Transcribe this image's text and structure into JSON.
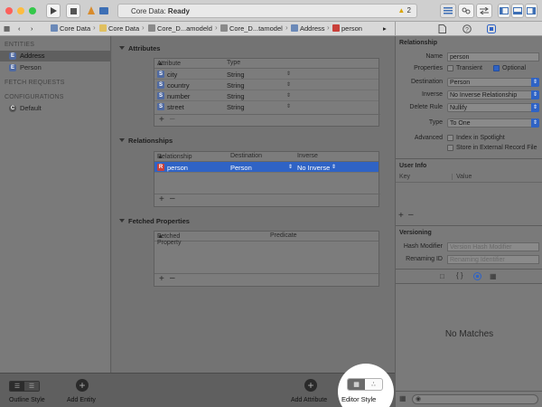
{
  "titlebar": {
    "status_prefix": "Core Data:",
    "status_value": "Ready",
    "warning_count": "2"
  },
  "breadcrumb": {
    "items": [
      "Core Data",
      "Core Data",
      "Core_D...amodeld",
      "Core_D...tamodel",
      "Address",
      "person"
    ]
  },
  "outline": {
    "entities_header": "ENTITIES",
    "entities": [
      {
        "label": "Address",
        "icon": "E",
        "selected": true
      },
      {
        "label": "Person",
        "icon": "E",
        "selected": false
      }
    ],
    "fetch_header": "FETCH REQUESTS",
    "config_header": "CONFIGURATIONS",
    "configurations": [
      {
        "label": "Default",
        "icon": "C"
      }
    ]
  },
  "attributes": {
    "title": "Attributes",
    "col_attribute": "Attribute",
    "col_type": "Type",
    "rows": [
      {
        "name": "city",
        "type": "String"
      },
      {
        "name": "country",
        "type": "String"
      },
      {
        "name": "number",
        "type": "String"
      },
      {
        "name": "street",
        "type": "String"
      }
    ]
  },
  "relationships": {
    "title": "Relationships",
    "col_relationship": "Relationship",
    "col_destination": "Destination",
    "col_inverse": "Inverse",
    "rows": [
      {
        "name": "person",
        "destination": "Person",
        "inverse": "No Inverse",
        "selected": true
      }
    ]
  },
  "fetched": {
    "title": "Fetched Properties",
    "col_property": "Fetched Property",
    "col_predicate": "Predicate"
  },
  "inspector": {
    "relationship_title": "Relationship",
    "name_label": "Name",
    "name_value": "person",
    "properties_label": "Properties",
    "transient_label": "Transient",
    "optional_label": "Optional",
    "destination_label": "Destination",
    "destination_value": "Person",
    "inverse_label": "Inverse",
    "inverse_value": "No Inverse Relationship",
    "delete_label": "Delete Rule",
    "delete_value": "Nullify",
    "type_label": "Type",
    "type_value": "To One",
    "advanced_label": "Advanced",
    "index_label": "Index in Spotlight",
    "external_label": "Store in External Record File",
    "userinfo_title": "User Info",
    "key_col": "Key",
    "value_col": "Value",
    "versioning_title": "Versioning",
    "hash_label": "Hash Modifier",
    "hash_placeholder": "Version Hash Modifier",
    "renaming_label": "Renaming ID",
    "renaming_placeholder": "Renaming Identifier",
    "no_matches": "No Matches"
  },
  "bottombar": {
    "outline_style": "Outline Style",
    "add_entity": "Add Entity",
    "add_attribute": "Add Attribute",
    "editor_style": "Editor Style"
  },
  "colors": {
    "selection": "#2f63c5",
    "entity_icon": "#4f69a0",
    "relationship_icon": "#c9403a"
  }
}
